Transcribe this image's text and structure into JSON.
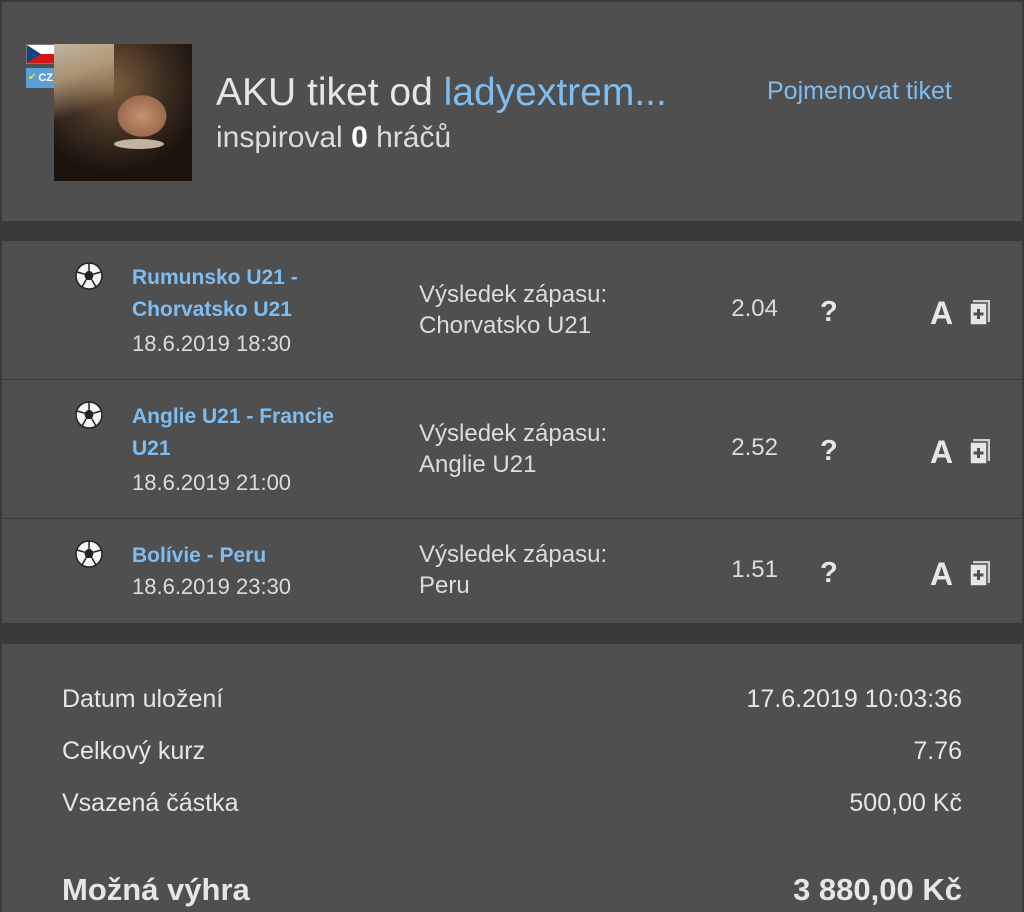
{
  "header": {
    "title_prefix": "AKU tiket od ",
    "author": "ladyextrem...",
    "inspired_prefix": "inspiroval ",
    "inspired_count": "0",
    "inspired_suffix": " hráčů",
    "rename_link": "Pojmenovat tiket",
    "country_badge": "CZ"
  },
  "bets": [
    {
      "match_line1": "Rumunsko U21 -",
      "match_line2": "Chorvatsko U21",
      "date": "18.6.2019 18:30",
      "market_line1": "Výsledek zápasu:",
      "market_line2": "Chorvatsko U21",
      "odds": "2.04",
      "help": "?",
      "stats_letter": "A"
    },
    {
      "match_line1": "Anglie U21 - Francie",
      "match_line2": "U21",
      "date": "18.6.2019 21:00",
      "market_line1": "Výsledek zápasu:",
      "market_line2": "Anglie U21",
      "odds": "2.52",
      "help": "?",
      "stats_letter": "A"
    },
    {
      "match_line1": "Bolívie - Peru",
      "match_line2": "",
      "date": "18.6.2019 23:30",
      "market_line1": "Výsledek zápasu:",
      "market_line2": "Peru",
      "odds": "1.51",
      "help": "?",
      "stats_letter": "A"
    }
  ],
  "summary": {
    "saved_label": "Datum uložení",
    "saved_value": "17.6.2019 10:03:36",
    "total_odds_label": "Celkový kurz",
    "total_odds_value": "7.76",
    "stake_label": "Vsazená částka",
    "stake_value": "500,00 Kč",
    "potential_win_label": "Možná výhra",
    "potential_win_value": "3 880,00 Kč"
  },
  "colors": {
    "background": "#3a3a3a",
    "panel": "#4f4f4f",
    "link": "#7fbdf0",
    "text": "#e6e6e6"
  },
  "icons": [
    "soccer-ball-icon",
    "help-icon",
    "book-plus-icon",
    "czech-flag-icon"
  ]
}
